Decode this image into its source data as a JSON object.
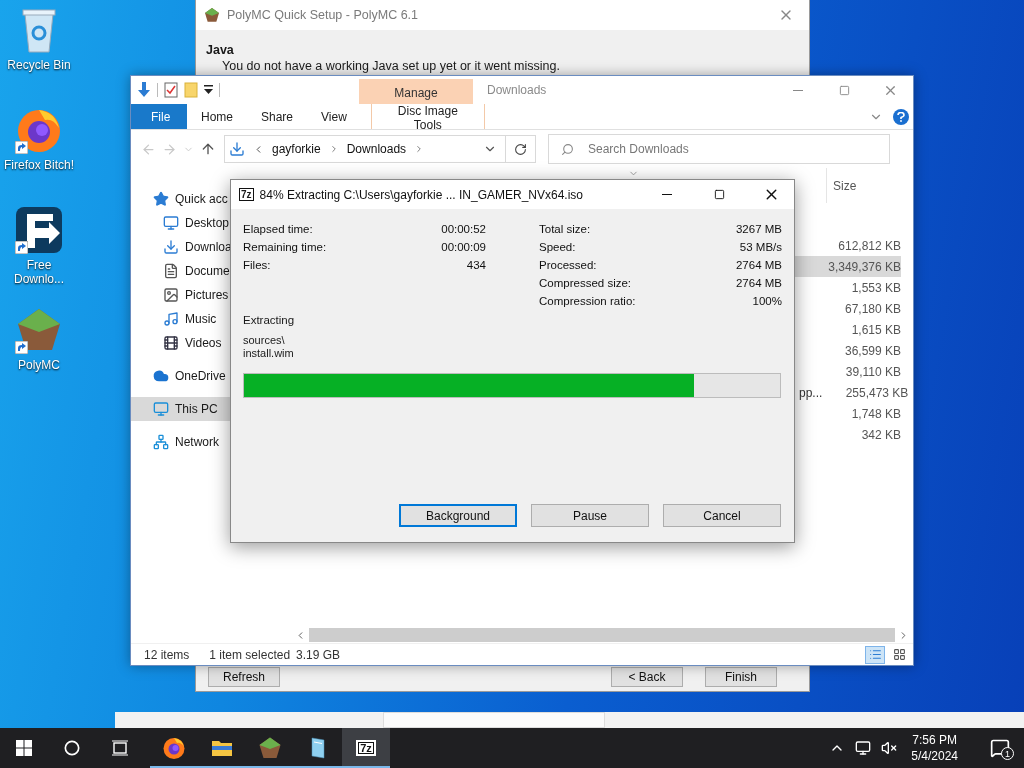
{
  "desktop_icons": [
    {
      "kind": "recycle-bin",
      "label": "Recycle Bin",
      "shortcut": false
    },
    {
      "kind": "firefox",
      "label": "Firefox Bitch!",
      "shortcut": true
    },
    {
      "kind": "download-manager",
      "label": "Free Downlo...",
      "shortcut": true
    },
    {
      "kind": "polymc",
      "label": "PolyMC",
      "shortcut": true
    }
  ],
  "setup_window": {
    "title": "PolyMC Quick Setup - PolyMC 6.1",
    "heading": "Java",
    "message": "You do not have a working Java set up yet or it went missing.",
    "buttons": [
      {
        "label": "Refresh",
        "kind": "left"
      },
      {
        "label": "< Back",
        "kind": "right"
      },
      {
        "label": "Finish",
        "kind": "right"
      }
    ]
  },
  "explorer": {
    "title": "Downloads",
    "context_tab": "Manage",
    "ribbon_tabs": [
      {
        "label": "File",
        "kind": "file"
      },
      {
        "label": "Home",
        "kind": "tab"
      },
      {
        "label": "Share",
        "kind": "tab"
      },
      {
        "label": "View",
        "kind": "tab"
      },
      {
        "label": "Disc Image Tools",
        "kind": "context"
      }
    ],
    "breadcrumb": [
      "gayforkie",
      "Downloads"
    ],
    "search": {
      "placeholder": "Search Downloads"
    },
    "nav_items": [
      {
        "label": "Quick acc",
        "kind": "star",
        "selected": false,
        "children": [
          {
            "label": "Desktop",
            "kind": "desktop",
            "selected": false
          },
          {
            "label": "Downloa",
            "kind": "download",
            "selected": false
          },
          {
            "label": "Docume",
            "kind": "document",
            "selected": false
          },
          {
            "label": "Pictures",
            "kind": "picture",
            "selected": false
          },
          {
            "label": "Music",
            "kind": "music",
            "selected": false
          },
          {
            "label": "Videos",
            "kind": "video",
            "selected": false
          }
        ]
      },
      {
        "label": "OneDrive",
        "kind": "cloud",
        "selected": false
      },
      {
        "label": "This PC",
        "kind": "pc",
        "selected": true
      },
      {
        "label": "Network",
        "kind": "network",
        "selected": false
      }
    ],
    "columns": [
      "Size"
    ],
    "rows": [
      {
        "size": "612,812 KB",
        "selected": false
      },
      {
        "size": "3,349,376 KB",
        "selected": true
      },
      {
        "size": "1,553 KB",
        "selected": false
      },
      {
        "size": "67,180 KB",
        "selected": false
      },
      {
        "size": "1,615 KB",
        "selected": false
      },
      {
        "size": "36,599 KB",
        "selected": false
      },
      {
        "size": "39,110 KB",
        "selected": false
      },
      {
        "column_1": "pp...",
        "size": "255,473 KB",
        "selected": false
      },
      {
        "size": "1,748 KB",
        "selected": false
      },
      {
        "size": "342 KB",
        "selected": false
      }
    ],
    "status_bar": {
      "count": "12 items",
      "selection": "1 item selected",
      "selection_size": "3.19 GB"
    }
  },
  "extract_dialog": {
    "app_badge": "7z",
    "title": "84% Extracting C:\\Users\\gayforkie ... IN_GAMER_NVx64.iso",
    "stats_left": [
      {
        "label": "Elapsed time:",
        "value": "00:00:52"
      },
      {
        "label": "Remaining time:",
        "value": "00:00:09"
      },
      {
        "label": "Files:",
        "value": "434"
      }
    ],
    "stats_right": [
      {
        "label": "Total size:",
        "value": "3267 MB"
      },
      {
        "label": "Speed:",
        "value": "53 MB/s"
      },
      {
        "label": "Processed:",
        "value": "2764 MB"
      },
      {
        "label": "Compressed size:",
        "value": "2764 MB"
      },
      {
        "label": "Compression ratio:",
        "value": "100%"
      }
    ],
    "operation": "Extracting",
    "current_file": [
      "sources\\",
      "install.wim"
    ],
    "progress": {
      "level": 0.84
    },
    "buttons": [
      {
        "label": "Background",
        "focused": true
      },
      {
        "label": "Pause",
        "focused": false
      },
      {
        "label": "Cancel",
        "focused": false
      }
    ]
  },
  "taskbar": {
    "apps": [
      {
        "kind": "firefox",
        "running": true,
        "selected": false
      },
      {
        "kind": "explorer",
        "running": true,
        "selected": false
      },
      {
        "kind": "polymc",
        "running": true,
        "selected": false
      },
      {
        "kind": "notepad",
        "running": true,
        "selected": false
      },
      {
        "kind": "sevenzip",
        "label": "7z",
        "running": true,
        "selected": true
      }
    ],
    "time": "7:56 PM",
    "date": "5/4/2024",
    "notifications": "1"
  }
}
